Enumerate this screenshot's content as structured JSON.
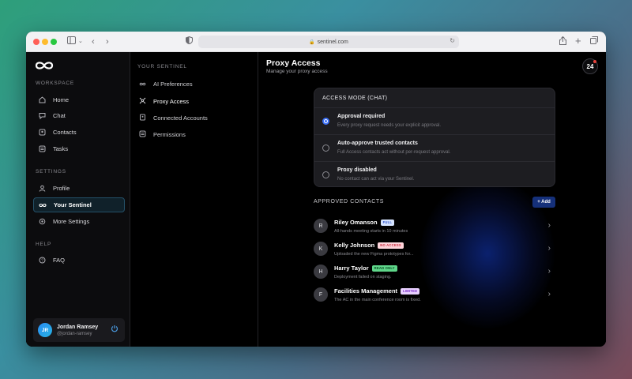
{
  "browser": {
    "url": "sentinel.com"
  },
  "sidebar": {
    "workspace_label": "WORKSPACE",
    "workspace_items": [
      {
        "label": "Home",
        "icon": "home-icon"
      },
      {
        "label": "Chat",
        "icon": "chat-icon"
      },
      {
        "label": "Contacts",
        "icon": "contacts-icon"
      },
      {
        "label": "Tasks",
        "icon": "tasks-icon"
      }
    ],
    "settings_label": "SETTINGS",
    "settings_items": [
      {
        "label": "Profile",
        "icon": "user-icon"
      },
      {
        "label": "Your Sentinel",
        "icon": "infinity-icon",
        "active": true
      },
      {
        "label": "More Settings",
        "icon": "gear-icon"
      }
    ],
    "help_label": "HELP",
    "help_items": [
      {
        "label": "FAQ",
        "icon": "help-circle-icon"
      }
    ],
    "user": {
      "initials": "JR",
      "name": "Jordan Ramsey",
      "handle": "@jordan-ramsey"
    }
  },
  "subnav": {
    "section_label": "YOUR SENTINEL",
    "items": [
      {
        "label": "AI Preferences",
        "icon": "infinity-icon"
      },
      {
        "label": "Proxy Access",
        "icon": "proxy-icon",
        "active": true
      },
      {
        "label": "Connected Accounts",
        "icon": "accounts-icon"
      },
      {
        "label": "Permissions",
        "icon": "permissions-icon"
      }
    ]
  },
  "main": {
    "title": "Proxy Access",
    "subtitle": "Manage your proxy access",
    "notification_count": "24",
    "access_mode": {
      "title": "ACCESS MODE (CHAT)",
      "options": [
        {
          "title": "Approval required",
          "description": "Every proxy request needs your explicit approval.",
          "selected": true
        },
        {
          "title": "Auto-approve trusted contacts",
          "description": "Full Access contacts act without per-request approval.",
          "selected": false
        },
        {
          "title": "Proxy disabled",
          "description": "No contact can act via your Sentinel.",
          "selected": false
        }
      ]
    },
    "approved_contacts": {
      "title": "APPROVED CONTACTS",
      "add_label": "+ Add",
      "contacts": [
        {
          "initial": "R",
          "name": "Riley Omanson",
          "badge": "FULL",
          "badge_bg": "#d6e4ff",
          "badge_fg": "#2a50c8",
          "message": "All-hands meeting starts in 10 minutes"
        },
        {
          "initial": "K",
          "name": "Kelly Johnson",
          "badge": "NO ACCESS",
          "badge_bg": "#ffd6dc",
          "badge_fg": "#c8283c",
          "message": "Uploaded the new Figma prototypes for..."
        },
        {
          "initial": "H",
          "name": "Harry Taylor",
          "badge": "READ ONLY",
          "badge_bg": "#5fd68a",
          "badge_fg": "#0a4a22",
          "message": "Deployment failed on staging."
        },
        {
          "initial": "F",
          "name": "Facilities Management",
          "badge": "LIMITED",
          "badge_bg": "#e8d0ff",
          "badge_fg": "#7a2ac8",
          "message": "The AC in the main conference room is fixed."
        }
      ]
    }
  }
}
